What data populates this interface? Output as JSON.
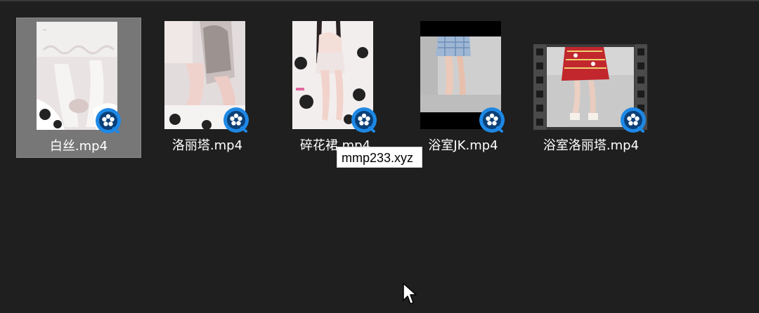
{
  "tooltip": {
    "text": "mmp233.xyz"
  },
  "files": [
    {
      "name": "白丝.mp4",
      "selected": true
    },
    {
      "name": "洛丽塔.mp4",
      "selected": false
    },
    {
      "name": "碎花裙.mp4",
      "selected": false
    },
    {
      "name": "浴室JK.mp4",
      "selected": false
    },
    {
      "name": "浴室洛丽塔.mp4",
      "selected": false
    }
  ],
  "colors": {
    "background": "#1f1f1f",
    "selection": "#777777",
    "badge_blue": "#1e88e5"
  },
  "icons": {
    "badge": "video-player-badge-icon",
    "cursor": "mouse-pointer-icon"
  }
}
